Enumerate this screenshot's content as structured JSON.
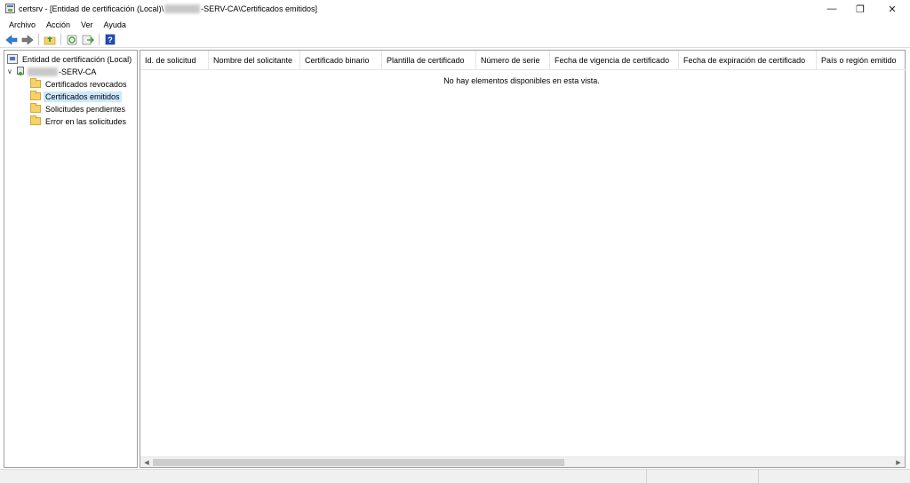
{
  "window": {
    "title_prefix": "certsrv - [Entidad de certificación (Local)\\",
    "title_suffix": "-SERV-CA\\Certificados emitidos]",
    "minimize_glyph": "—",
    "restore_glyph": "❐",
    "close_glyph": "✕"
  },
  "menu": [
    "Archivo",
    "Acción",
    "Ver",
    "Ayuda"
  ],
  "toolbar": {
    "help_label": "?"
  },
  "tree": {
    "root_label": "Entidad de certificación (Local)",
    "ca_suffix": "-SERV-CA",
    "items": [
      "Certificados revocados",
      "Certificados emitidos",
      "Solicitudes pendientes",
      "Error en las solicitudes"
    ],
    "selected": "Certificados emitidos"
  },
  "list": {
    "columns": [
      "Id. de solicitud",
      "Nombre del solicitante",
      "Certificado binario",
      "Plantilla de certificado",
      "Número de serie",
      "Fecha de vigencia de certificado",
      "Fecha de expiración de certificado",
      "País o región emitido"
    ],
    "empty_message": "No hay elementos disponibles en esta vista."
  },
  "colors": {
    "selection": "#cce8ff",
    "nav_arrow": "#2f7fd6",
    "help_icon": "#1f4fb5"
  }
}
